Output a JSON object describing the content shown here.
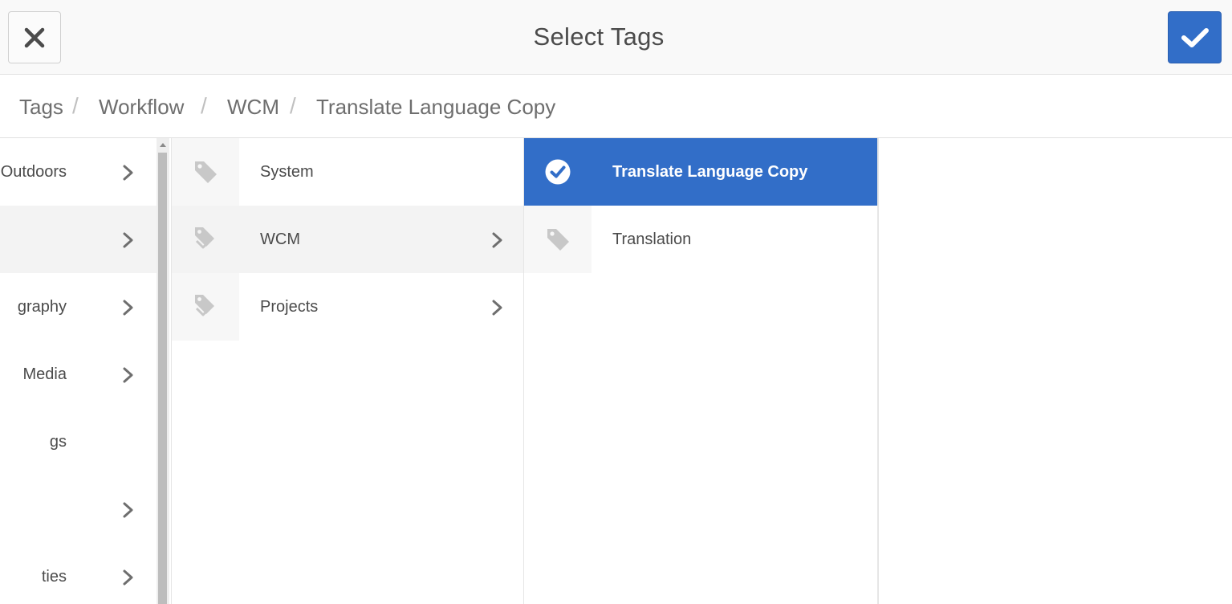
{
  "dialog": {
    "title": "Select Tags",
    "close_icon": "close-icon",
    "confirm_icon": "checkmark-icon",
    "accent_color": "#326ec8"
  },
  "breadcrumb": {
    "items": [
      "Tags",
      "Workflow",
      "WCM",
      "Translate Language Copy"
    ],
    "separator": "/"
  },
  "column1": {
    "items": [
      {
        "label": "Outdoors",
        "has_children": true
      },
      {
        "label": "",
        "has_children": true,
        "active": true
      },
      {
        "label": "graphy",
        "has_children": true
      },
      {
        "label": "Media",
        "has_children": true
      },
      {
        "label": "gs",
        "has_children": false
      },
      {
        "label": "",
        "has_children": true
      },
      {
        "label": "ties",
        "has_children": true
      }
    ]
  },
  "column2": {
    "items": [
      {
        "label": "System",
        "icon": "tag-icon",
        "has_children": false
      },
      {
        "label": "WCM",
        "icon": "tag-stack-icon",
        "has_children": true,
        "active": true
      },
      {
        "label": "Projects",
        "icon": "tag-stack-icon",
        "has_children": true
      }
    ]
  },
  "column3": {
    "items": [
      {
        "label": "Translate Language Copy",
        "icon": "checkmark-circle-icon",
        "selected": true
      },
      {
        "label": "Translation",
        "icon": "tag-icon",
        "selected": false
      }
    ]
  }
}
